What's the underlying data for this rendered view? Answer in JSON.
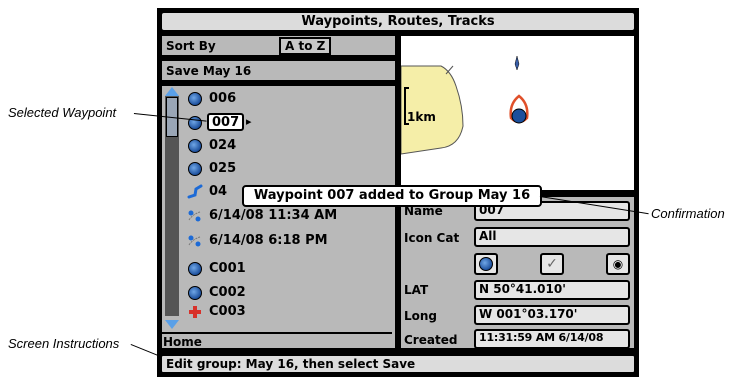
{
  "title": "Waypoints, Routes, Tracks",
  "sort": {
    "label": "Sort By",
    "value": "A to Z"
  },
  "group_name": "Save May 16",
  "list": [
    {
      "icon": "waypoint-icon",
      "label": "006"
    },
    {
      "icon": "waypoint-icon",
      "label": "007",
      "selected": true
    },
    {
      "icon": "waypoint-icon",
      "label": "024"
    },
    {
      "icon": "waypoint-icon",
      "label": "025"
    },
    {
      "icon": "route-icon",
      "label": "04"
    },
    {
      "icon": "track-icon",
      "label": "6/14/08 11:34 AM"
    },
    {
      "icon": "track-icon",
      "label": "6/14/08 6:18 PM"
    },
    {
      "icon": "waypoint-icon",
      "label": "C001"
    },
    {
      "icon": "waypoint-icon",
      "label": "C002"
    },
    {
      "icon": "cross-icon",
      "label": "C003"
    }
  ],
  "home": "Home",
  "map": {
    "scale": "1km"
  },
  "details": {
    "name_label": "Name",
    "name_value": "007",
    "iconcat_label": "Icon Cat",
    "iconcat_value": "All",
    "lat_label": "LAT",
    "lat_value": "N 50°41.010'",
    "long_label": "Long",
    "long_value": "W 001°03.170'",
    "created_label": "Created",
    "created_value": "11:31:59 AM 6/14/08"
  },
  "popup": "Waypoint 007 added to Group May 16",
  "status": "Edit group: May 16, then select Save",
  "callouts": {
    "selected_waypoint": "Selected Waypoint",
    "confirmation": "Confirmation",
    "screen_instructions": "Screen Instructions"
  },
  "colors": {
    "screen_bg": "#b9b9b9",
    "map_bg": "#ffffff",
    "land": "#f5eea8",
    "waypoint": "#1c4f9c",
    "route": "#1c6ad6",
    "cross": "#d8312a",
    "scroll": "#5aa0e8"
  }
}
